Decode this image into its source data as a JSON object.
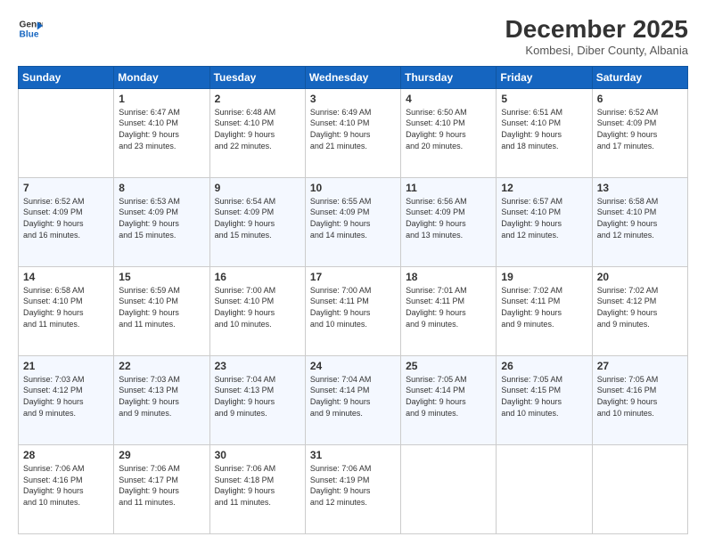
{
  "header": {
    "logo_line1": "General",
    "logo_line2": "Blue",
    "month": "December 2025",
    "location": "Kombesi, Diber County, Albania"
  },
  "weekdays": [
    "Sunday",
    "Monday",
    "Tuesday",
    "Wednesday",
    "Thursday",
    "Friday",
    "Saturday"
  ],
  "weeks": [
    [
      {
        "day": "",
        "info": ""
      },
      {
        "day": "1",
        "info": "Sunrise: 6:47 AM\nSunset: 4:10 PM\nDaylight: 9 hours\nand 23 minutes."
      },
      {
        "day": "2",
        "info": "Sunrise: 6:48 AM\nSunset: 4:10 PM\nDaylight: 9 hours\nand 22 minutes."
      },
      {
        "day": "3",
        "info": "Sunrise: 6:49 AM\nSunset: 4:10 PM\nDaylight: 9 hours\nand 21 minutes."
      },
      {
        "day": "4",
        "info": "Sunrise: 6:50 AM\nSunset: 4:10 PM\nDaylight: 9 hours\nand 20 minutes."
      },
      {
        "day": "5",
        "info": "Sunrise: 6:51 AM\nSunset: 4:10 PM\nDaylight: 9 hours\nand 18 minutes."
      },
      {
        "day": "6",
        "info": "Sunrise: 6:52 AM\nSunset: 4:09 PM\nDaylight: 9 hours\nand 17 minutes."
      }
    ],
    [
      {
        "day": "7",
        "info": "Sunrise: 6:52 AM\nSunset: 4:09 PM\nDaylight: 9 hours\nand 16 minutes."
      },
      {
        "day": "8",
        "info": "Sunrise: 6:53 AM\nSunset: 4:09 PM\nDaylight: 9 hours\nand 15 minutes."
      },
      {
        "day": "9",
        "info": "Sunrise: 6:54 AM\nSunset: 4:09 PM\nDaylight: 9 hours\nand 15 minutes."
      },
      {
        "day": "10",
        "info": "Sunrise: 6:55 AM\nSunset: 4:09 PM\nDaylight: 9 hours\nand 14 minutes."
      },
      {
        "day": "11",
        "info": "Sunrise: 6:56 AM\nSunset: 4:09 PM\nDaylight: 9 hours\nand 13 minutes."
      },
      {
        "day": "12",
        "info": "Sunrise: 6:57 AM\nSunset: 4:10 PM\nDaylight: 9 hours\nand 12 minutes."
      },
      {
        "day": "13",
        "info": "Sunrise: 6:58 AM\nSunset: 4:10 PM\nDaylight: 9 hours\nand 12 minutes."
      }
    ],
    [
      {
        "day": "14",
        "info": "Sunrise: 6:58 AM\nSunset: 4:10 PM\nDaylight: 9 hours\nand 11 minutes."
      },
      {
        "day": "15",
        "info": "Sunrise: 6:59 AM\nSunset: 4:10 PM\nDaylight: 9 hours\nand 11 minutes."
      },
      {
        "day": "16",
        "info": "Sunrise: 7:00 AM\nSunset: 4:10 PM\nDaylight: 9 hours\nand 10 minutes."
      },
      {
        "day": "17",
        "info": "Sunrise: 7:00 AM\nSunset: 4:11 PM\nDaylight: 9 hours\nand 10 minutes."
      },
      {
        "day": "18",
        "info": "Sunrise: 7:01 AM\nSunset: 4:11 PM\nDaylight: 9 hours\nand 9 minutes."
      },
      {
        "day": "19",
        "info": "Sunrise: 7:02 AM\nSunset: 4:11 PM\nDaylight: 9 hours\nand 9 minutes."
      },
      {
        "day": "20",
        "info": "Sunrise: 7:02 AM\nSunset: 4:12 PM\nDaylight: 9 hours\nand 9 minutes."
      }
    ],
    [
      {
        "day": "21",
        "info": "Sunrise: 7:03 AM\nSunset: 4:12 PM\nDaylight: 9 hours\nand 9 minutes."
      },
      {
        "day": "22",
        "info": "Sunrise: 7:03 AM\nSunset: 4:13 PM\nDaylight: 9 hours\nand 9 minutes."
      },
      {
        "day": "23",
        "info": "Sunrise: 7:04 AM\nSunset: 4:13 PM\nDaylight: 9 hours\nand 9 minutes."
      },
      {
        "day": "24",
        "info": "Sunrise: 7:04 AM\nSunset: 4:14 PM\nDaylight: 9 hours\nand 9 minutes."
      },
      {
        "day": "25",
        "info": "Sunrise: 7:05 AM\nSunset: 4:14 PM\nDaylight: 9 hours\nand 9 minutes."
      },
      {
        "day": "26",
        "info": "Sunrise: 7:05 AM\nSunset: 4:15 PM\nDaylight: 9 hours\nand 10 minutes."
      },
      {
        "day": "27",
        "info": "Sunrise: 7:05 AM\nSunset: 4:16 PM\nDaylight: 9 hours\nand 10 minutes."
      }
    ],
    [
      {
        "day": "28",
        "info": "Sunrise: 7:06 AM\nSunset: 4:16 PM\nDaylight: 9 hours\nand 10 minutes."
      },
      {
        "day": "29",
        "info": "Sunrise: 7:06 AM\nSunset: 4:17 PM\nDaylight: 9 hours\nand 11 minutes."
      },
      {
        "day": "30",
        "info": "Sunrise: 7:06 AM\nSunset: 4:18 PM\nDaylight: 9 hours\nand 11 minutes."
      },
      {
        "day": "31",
        "info": "Sunrise: 7:06 AM\nSunset: 4:19 PM\nDaylight: 9 hours\nand 12 minutes."
      },
      {
        "day": "",
        "info": ""
      },
      {
        "day": "",
        "info": ""
      },
      {
        "day": "",
        "info": ""
      }
    ]
  ]
}
